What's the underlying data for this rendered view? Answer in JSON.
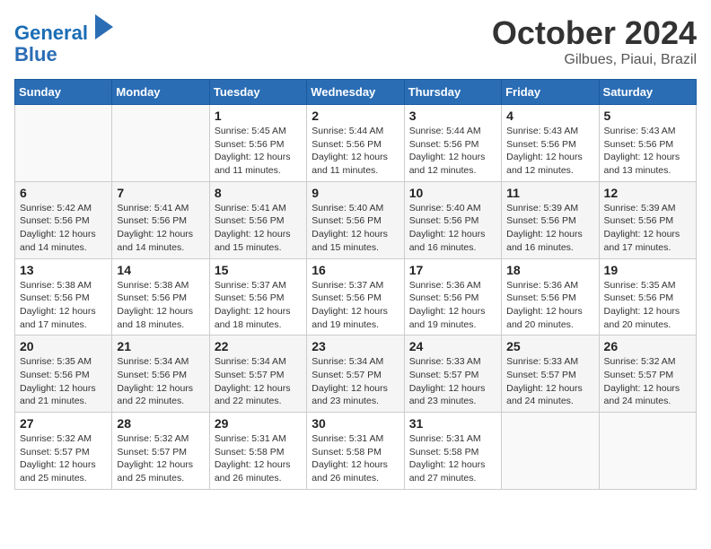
{
  "header": {
    "logo_line1": "General",
    "logo_line2": "Blue",
    "month": "October 2024",
    "location": "Gilbues, Piaui, Brazil"
  },
  "weekdays": [
    "Sunday",
    "Monday",
    "Tuesday",
    "Wednesday",
    "Thursday",
    "Friday",
    "Saturday"
  ],
  "weeks": [
    [
      {
        "day": "",
        "info": ""
      },
      {
        "day": "",
        "info": ""
      },
      {
        "day": "1",
        "info": "Sunrise: 5:45 AM\nSunset: 5:56 PM\nDaylight: 12 hours and 11 minutes."
      },
      {
        "day": "2",
        "info": "Sunrise: 5:44 AM\nSunset: 5:56 PM\nDaylight: 12 hours and 11 minutes."
      },
      {
        "day": "3",
        "info": "Sunrise: 5:44 AM\nSunset: 5:56 PM\nDaylight: 12 hours and 12 minutes."
      },
      {
        "day": "4",
        "info": "Sunrise: 5:43 AM\nSunset: 5:56 PM\nDaylight: 12 hours and 12 minutes."
      },
      {
        "day": "5",
        "info": "Sunrise: 5:43 AM\nSunset: 5:56 PM\nDaylight: 12 hours and 13 minutes."
      }
    ],
    [
      {
        "day": "6",
        "info": "Sunrise: 5:42 AM\nSunset: 5:56 PM\nDaylight: 12 hours and 14 minutes."
      },
      {
        "day": "7",
        "info": "Sunrise: 5:41 AM\nSunset: 5:56 PM\nDaylight: 12 hours and 14 minutes."
      },
      {
        "day": "8",
        "info": "Sunrise: 5:41 AM\nSunset: 5:56 PM\nDaylight: 12 hours and 15 minutes."
      },
      {
        "day": "9",
        "info": "Sunrise: 5:40 AM\nSunset: 5:56 PM\nDaylight: 12 hours and 15 minutes."
      },
      {
        "day": "10",
        "info": "Sunrise: 5:40 AM\nSunset: 5:56 PM\nDaylight: 12 hours and 16 minutes."
      },
      {
        "day": "11",
        "info": "Sunrise: 5:39 AM\nSunset: 5:56 PM\nDaylight: 12 hours and 16 minutes."
      },
      {
        "day": "12",
        "info": "Sunrise: 5:39 AM\nSunset: 5:56 PM\nDaylight: 12 hours and 17 minutes."
      }
    ],
    [
      {
        "day": "13",
        "info": "Sunrise: 5:38 AM\nSunset: 5:56 PM\nDaylight: 12 hours and 17 minutes."
      },
      {
        "day": "14",
        "info": "Sunrise: 5:38 AM\nSunset: 5:56 PM\nDaylight: 12 hours and 18 minutes."
      },
      {
        "day": "15",
        "info": "Sunrise: 5:37 AM\nSunset: 5:56 PM\nDaylight: 12 hours and 18 minutes."
      },
      {
        "day": "16",
        "info": "Sunrise: 5:37 AM\nSunset: 5:56 PM\nDaylight: 12 hours and 19 minutes."
      },
      {
        "day": "17",
        "info": "Sunrise: 5:36 AM\nSunset: 5:56 PM\nDaylight: 12 hours and 19 minutes."
      },
      {
        "day": "18",
        "info": "Sunrise: 5:36 AM\nSunset: 5:56 PM\nDaylight: 12 hours and 20 minutes."
      },
      {
        "day": "19",
        "info": "Sunrise: 5:35 AM\nSunset: 5:56 PM\nDaylight: 12 hours and 20 minutes."
      }
    ],
    [
      {
        "day": "20",
        "info": "Sunrise: 5:35 AM\nSunset: 5:56 PM\nDaylight: 12 hours and 21 minutes."
      },
      {
        "day": "21",
        "info": "Sunrise: 5:34 AM\nSunset: 5:56 PM\nDaylight: 12 hours and 22 minutes."
      },
      {
        "day": "22",
        "info": "Sunrise: 5:34 AM\nSunset: 5:57 PM\nDaylight: 12 hours and 22 minutes."
      },
      {
        "day": "23",
        "info": "Sunrise: 5:34 AM\nSunset: 5:57 PM\nDaylight: 12 hours and 23 minutes."
      },
      {
        "day": "24",
        "info": "Sunrise: 5:33 AM\nSunset: 5:57 PM\nDaylight: 12 hours and 23 minutes."
      },
      {
        "day": "25",
        "info": "Sunrise: 5:33 AM\nSunset: 5:57 PM\nDaylight: 12 hours and 24 minutes."
      },
      {
        "day": "26",
        "info": "Sunrise: 5:32 AM\nSunset: 5:57 PM\nDaylight: 12 hours and 24 minutes."
      }
    ],
    [
      {
        "day": "27",
        "info": "Sunrise: 5:32 AM\nSunset: 5:57 PM\nDaylight: 12 hours and 25 minutes."
      },
      {
        "day": "28",
        "info": "Sunrise: 5:32 AM\nSunset: 5:57 PM\nDaylight: 12 hours and 25 minutes."
      },
      {
        "day": "29",
        "info": "Sunrise: 5:31 AM\nSunset: 5:58 PM\nDaylight: 12 hours and 26 minutes."
      },
      {
        "day": "30",
        "info": "Sunrise: 5:31 AM\nSunset: 5:58 PM\nDaylight: 12 hours and 26 minutes."
      },
      {
        "day": "31",
        "info": "Sunrise: 5:31 AM\nSunset: 5:58 PM\nDaylight: 12 hours and 27 minutes."
      },
      {
        "day": "",
        "info": ""
      },
      {
        "day": "",
        "info": ""
      }
    ]
  ]
}
